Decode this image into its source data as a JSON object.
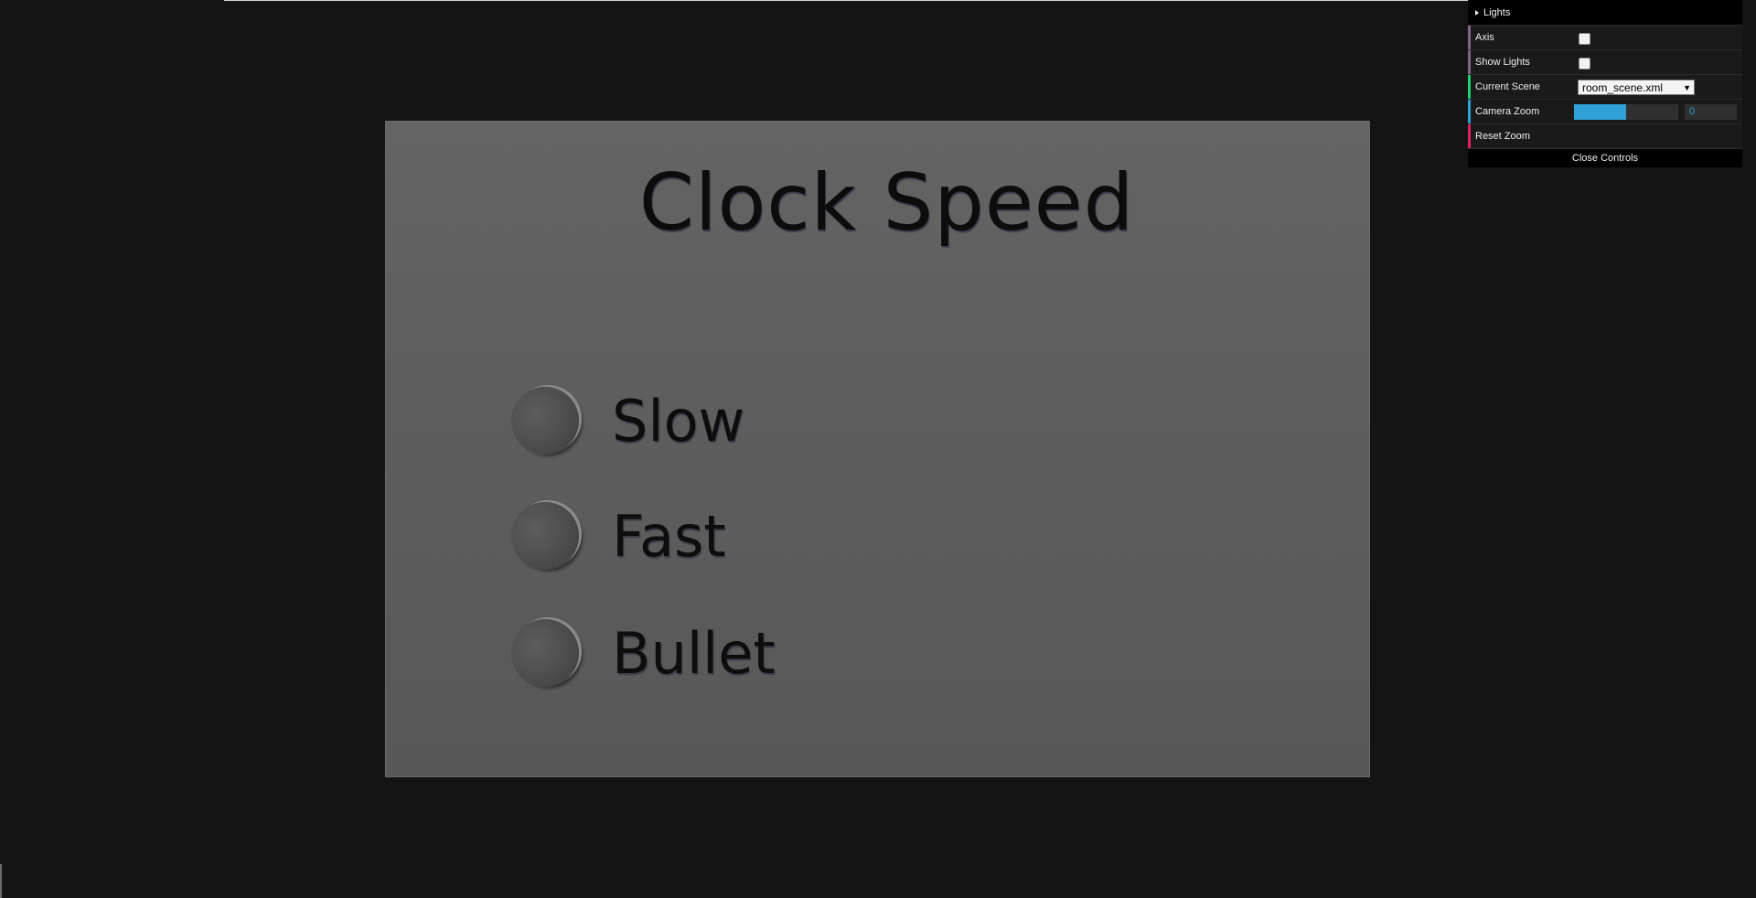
{
  "scene": {
    "board_title": "Clock Speed",
    "options": [
      {
        "label": "Slow"
      },
      {
        "label": "Fast"
      },
      {
        "label": "Bullet"
      }
    ]
  },
  "controls": {
    "lights_folder": "Lights",
    "axis_label": "Axis",
    "axis_checked": false,
    "show_lights_label": "Show Lights",
    "show_lights_checked": false,
    "current_scene_label": "Current Scene",
    "current_scene_value": "room_scene.xml",
    "camera_zoom_label": "Camera Zoom",
    "camera_zoom_value": "0",
    "camera_zoom_fill_fraction": 0.5,
    "reset_zoom_label": "Reset Zoom",
    "close_controls_label": "Close Controls",
    "colors": {
      "axis": "#806787",
      "show_lights": "#806787",
      "current_scene": "#1ed36f",
      "camera_zoom": "#2fa1d6",
      "reset_zoom": "#e61d5f",
      "slider_fill": "#2fa1d6"
    }
  }
}
